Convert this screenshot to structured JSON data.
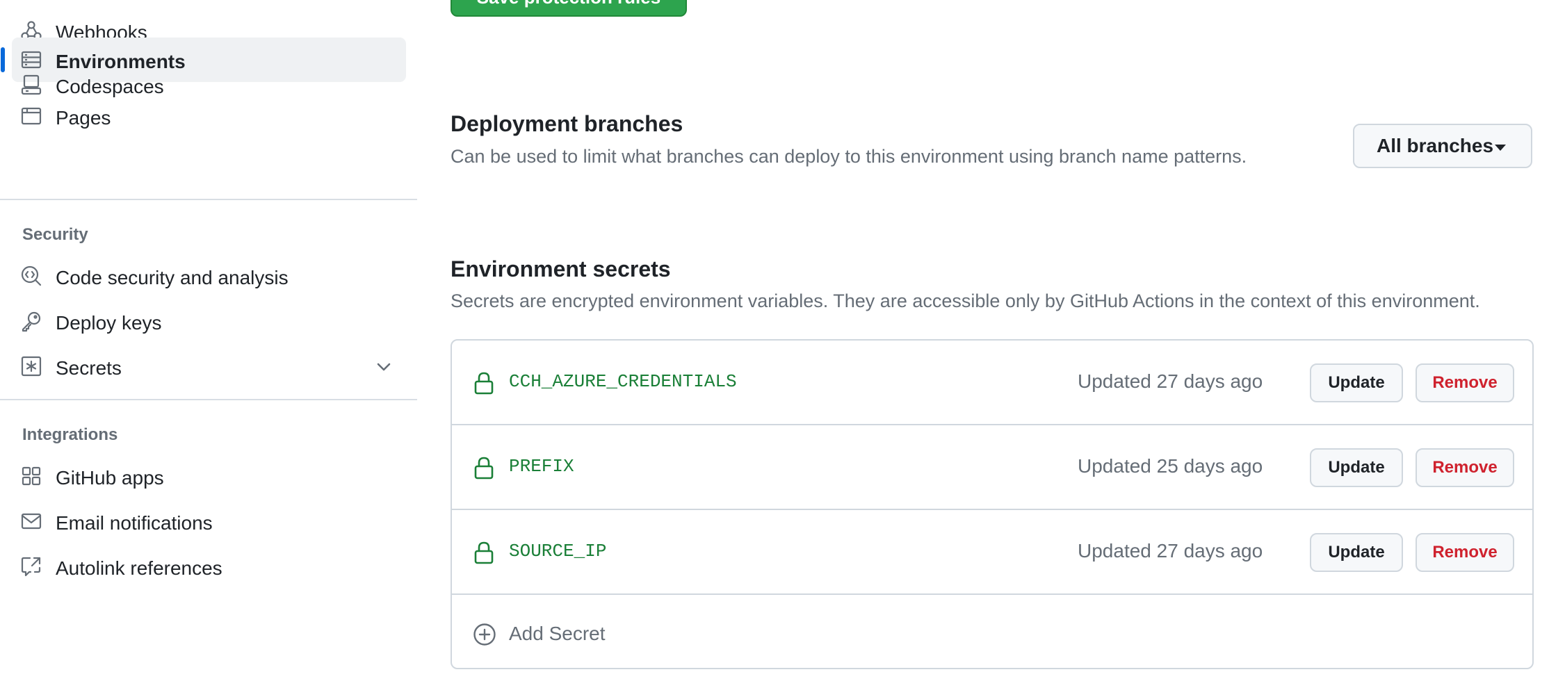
{
  "sidebar": {
    "items_top": [
      {
        "label": "Webhooks",
        "icon": "webhook-icon"
      },
      {
        "label": "Environments",
        "icon": "server-icon",
        "active": true
      },
      {
        "label": "Codespaces",
        "icon": "codespaces-icon"
      },
      {
        "label": "Pages",
        "icon": "browser-icon"
      }
    ],
    "security_heading": "Security",
    "security_items": [
      {
        "label": "Code security and analysis",
        "icon": "codescan-icon"
      },
      {
        "label": "Deploy keys",
        "icon": "key-icon"
      },
      {
        "label": "Secrets",
        "icon": "key-asterisk-icon"
      }
    ],
    "integrations_heading": "Integrations",
    "integrations_items": [
      {
        "label": "GitHub apps",
        "icon": "apps-icon"
      },
      {
        "label": "Email notifications",
        "icon": "mail-icon"
      },
      {
        "label": "Autolink references",
        "icon": "cross-reference-icon"
      }
    ]
  },
  "main": {
    "save_button_label": "Save protection rules",
    "deployment_branches": {
      "title": "Deployment branches",
      "description": "Can be used to limit what branches can deploy to this environment using branch name patterns.",
      "dropdown_value": "All branches"
    },
    "environment_secrets": {
      "title": "Environment secrets",
      "description": "Secrets are encrypted environment variables. They are accessible only by GitHub Actions in the context of this environment.",
      "secrets": [
        {
          "name": "CCH_AZURE_CREDENTIALS",
          "updated": "Updated 27 days ago"
        },
        {
          "name": "PREFIX",
          "updated": "Updated 25 days ago"
        },
        {
          "name": "SOURCE_IP",
          "updated": "Updated 27 days ago"
        }
      ],
      "update_label": "Update",
      "remove_label": "Remove",
      "add_label": "Add Secret"
    }
  },
  "colors": {
    "accent": "#0969da",
    "success": "#1a7f37",
    "danger": "#cf222e",
    "muted": "#656d76"
  }
}
